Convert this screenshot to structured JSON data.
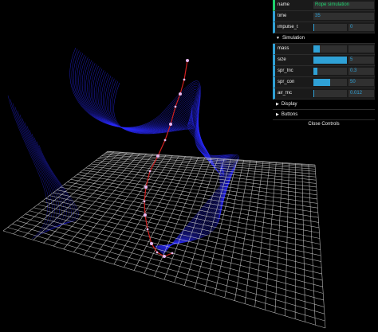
{
  "gui": {
    "name": {
      "label": "name",
      "value": "Rope simulation"
    },
    "time": {
      "label": "time",
      "value": "35"
    },
    "impulse": {
      "label": "impulse_t",
      "value": "0",
      "fraction": 0.02
    },
    "simulation_folder": {
      "label": "Simulation",
      "open": true
    },
    "params": [
      {
        "label": "mass",
        "value": "",
        "fraction": 0.2
      },
      {
        "label": "size",
        "value": "5",
        "fraction": 1.0
      },
      {
        "label": "spr_fric",
        "value": "0.3",
        "fraction": 0.12
      },
      {
        "label": "spr_con",
        "value": "50",
        "fraction": 0.5
      },
      {
        "label": "air_fric",
        "value": "0.012",
        "fraction": 0.03
      }
    ],
    "display_folder": {
      "label": "Display",
      "open": false
    },
    "buttons_folder": {
      "label": "Buttons",
      "open": false
    },
    "close_label": "Close Controls"
  },
  "colors": {
    "rope": "#d02020",
    "grid": "#d0d0d0",
    "trails": "#2a2aff",
    "nodes": "#e8b8f0",
    "accent_text": "#1ed36f",
    "accent_num": "#2fa1d6"
  },
  "icons": {
    "folder_open": "triangle-down-icon",
    "folder_closed": "triangle-right-icon"
  }
}
